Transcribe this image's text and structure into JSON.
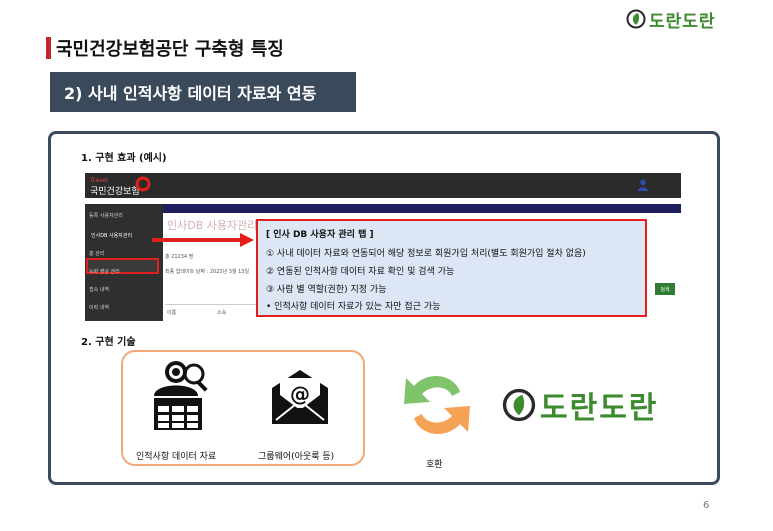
{
  "brand": {
    "name": "도란도란",
    "color": "#3d8b2f"
  },
  "title": "국민건강보험공단 구축형 특징",
  "section_pill": "2) 사내 인적사항 데이터 자료와 연동",
  "subsection1": "1. 구현 효과 (예시)",
  "subsection2": "2. 구현 기술",
  "screenshot": {
    "logo_small": "Travel",
    "logo": "국민건강보험",
    "sidebar": [
      {
        "label": "등록 사용자관리",
        "icon": "users-icon"
      },
      {
        "label": "인사DB 사용자관리",
        "icon": "user-db-icon",
        "active": true
      },
      {
        "label": "홈 관리",
        "icon": "home-icon"
      },
      {
        "label": "녹화 영상 관리",
        "icon": "video-icon"
      },
      {
        "label": "접속 내역",
        "icon": "access-icon"
      },
      {
        "label": "이력 내역",
        "icon": "history-icon"
      }
    ],
    "main_title": "인사DB 사용자관리",
    "count_text": "총 21234 명",
    "update_text": "최종 업데이트 날짜 : 2023년 3월 13일",
    "search_button": "검색",
    "table_col1": "이름",
    "table_col2": "소속"
  },
  "callout": {
    "header": "[ 인사 DB 사용자 관리 탭 ]",
    "items": [
      "①  사내 데이터 자료와 연동되어 해당 정보로 회원가입 처리(별도 회원가입 절차 없음)",
      "②  연동된 인적사항 데이터 자료 확인 및 검색 가능",
      "③  사람 별 역할(권한) 지정 가능",
      "  • 인적사항 데이터 자료가 있는 자만 접근 가능"
    ]
  },
  "tech": {
    "label_person": "인적사항 데이터 자료",
    "label_mail": "그룹웨어(아웃룩 등)",
    "label_sync": "호환"
  },
  "page_number": "6",
  "colors": {
    "accent_red": "#c0272d",
    "navy": "#3b4a5b",
    "orange": "#f0a878",
    "green": "#3d8b2f"
  }
}
